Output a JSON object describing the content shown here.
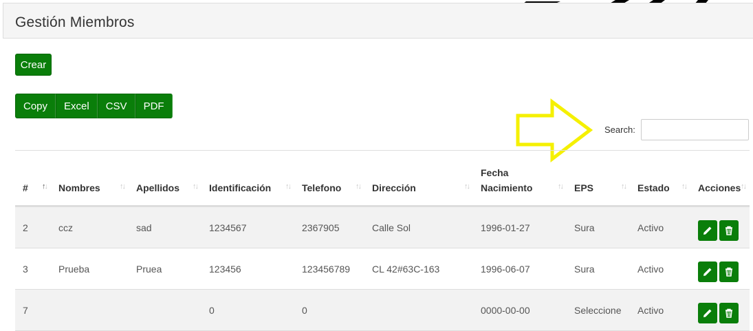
{
  "page": {
    "title": "Gestión Miembros"
  },
  "toolbar": {
    "create_label": "Crear"
  },
  "export_buttons": [
    "Copy",
    "Excel",
    "CSV",
    "PDF"
  ],
  "search": {
    "label": "Search:",
    "value": ""
  },
  "table": {
    "headers": [
      "#",
      "Nombres",
      "Apellidos",
      "Identificación",
      "Telefono",
      "Dirección",
      "Fecha Nacimiento",
      "EPS",
      "Estado",
      "Acciones"
    ],
    "rows": [
      [
        "2",
        "ccz",
        "sad",
        "1234567",
        "2367905",
        "Calle Sol",
        "1996-01-27",
        "Sura",
        "Activo"
      ],
      [
        "3",
        "Prueba",
        "Pruea",
        "123456",
        "123456789",
        "CL 42#63C-163",
        "1996-06-07",
        "Sura",
        "Activo"
      ],
      [
        "7",
        "",
        "",
        "0",
        "0",
        "",
        "0000-00-00",
        "Seleccione",
        "Activo"
      ]
    ]
  },
  "icons": {
    "edit": "pencil-icon",
    "delete": "trash-icon",
    "annotation": "yellow-arrow"
  },
  "colors": {
    "button_green": "#0a7e0a",
    "arrow_yellow": "#f5f000",
    "row_stripe": "#f2f2f2"
  }
}
